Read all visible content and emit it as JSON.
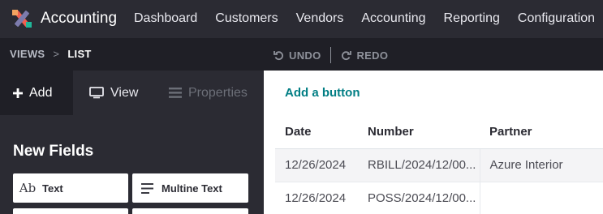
{
  "navbar": {
    "app_name": "Accounting",
    "menu": [
      "Dashboard",
      "Customers",
      "Vendors",
      "Accounting",
      "Reporting",
      "Configuration"
    ],
    "logo_colors": [
      "#f06050",
      "#f4a460",
      "#7c7bad",
      "#21b799"
    ]
  },
  "studio": {
    "breadcrumb": {
      "views": "VIEWS",
      "separator": ">",
      "current": "LIST"
    },
    "undo_label": "UNDO",
    "redo_label": "REDO"
  },
  "sidebar": {
    "tabs": [
      {
        "label": "Add",
        "icon": "plus-icon",
        "state": "active"
      },
      {
        "label": "View",
        "icon": "monitor-icon",
        "state": "normal"
      },
      {
        "label": "Properties",
        "icon": "list-icon",
        "state": "disabled"
      }
    ],
    "section_title": "New Fields",
    "fields": [
      {
        "icon_text": "Ab",
        "label": "Text"
      },
      {
        "icon": "multiline-icon",
        "label": "Multine Text"
      }
    ]
  },
  "main": {
    "add_button_label": "Add a button",
    "columns": [
      "Date",
      "Number",
      "Partner"
    ],
    "rows": [
      [
        "12/26/2024",
        "RBILL/2024/12/00...",
        "Azure Interior"
      ],
      [
        "12/26/2024",
        "POSS/2024/12/00...",
        ""
      ]
    ]
  },
  "colors": {
    "navbar_bg": "#2b2b33",
    "subbar_bg": "#1f1f26",
    "accent": "#017e84"
  }
}
